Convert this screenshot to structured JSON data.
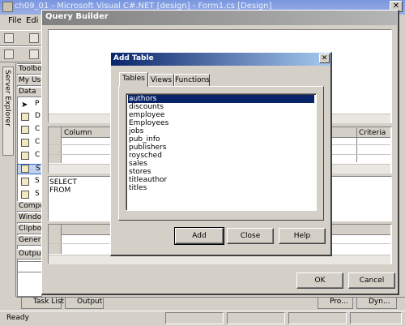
{
  "vs": {
    "title": "ch09_01 - Microsoft Visual C#.NET [design] - Form1.cs [Design]",
    "close": "✕",
    "menu": [
      {
        "label": "File"
      },
      {
        "label": "Edi"
      }
    ],
    "server_explorer": "Server Explorer",
    "toolbox": {
      "header": "Toolbo",
      "my_user": "My Use",
      "data": "Data",
      "items": [
        {
          "label": "P"
        },
        {
          "label": "D"
        },
        {
          "label": "C"
        },
        {
          "label": "C"
        },
        {
          "label": "C"
        },
        {
          "label": "S"
        },
        {
          "label": "S"
        },
        {
          "label": "S"
        }
      ],
      "component": "Compo",
      "windows": "Windo",
      "clipboard": "Clipbo",
      "general": "Genera",
      "output": "Outpu"
    },
    "bottom_tabs": [
      {
        "label": "Task List"
      },
      {
        "label": "Output"
      }
    ],
    "right_tabs": [
      {
        "label": "Pro..."
      },
      {
        "label": "Dyn..."
      }
    ],
    "status": "Ready"
  },
  "query_builder": {
    "title": "Query Builder",
    "grid": {
      "column_header": "Column",
      "criteria_header": "Criteria"
    },
    "sql_lines": [
      "SELECT",
      "FROM"
    ],
    "ok": "OK",
    "cancel": "Cancel"
  },
  "add_table": {
    "title": "Add Table",
    "close": "✕",
    "tabs": [
      {
        "label": "Tables"
      },
      {
        "label": "Views"
      },
      {
        "label": "Functions"
      }
    ],
    "tables": [
      "authors",
      "discounts",
      "employee",
      "Employees",
      "jobs",
      "pub_info",
      "publishers",
      "roysched",
      "sales",
      "stores",
      "titleauthor",
      "titles"
    ],
    "selected": "authors",
    "buttons": {
      "add": "Add",
      "close": "Close",
      "help": "Help"
    }
  }
}
